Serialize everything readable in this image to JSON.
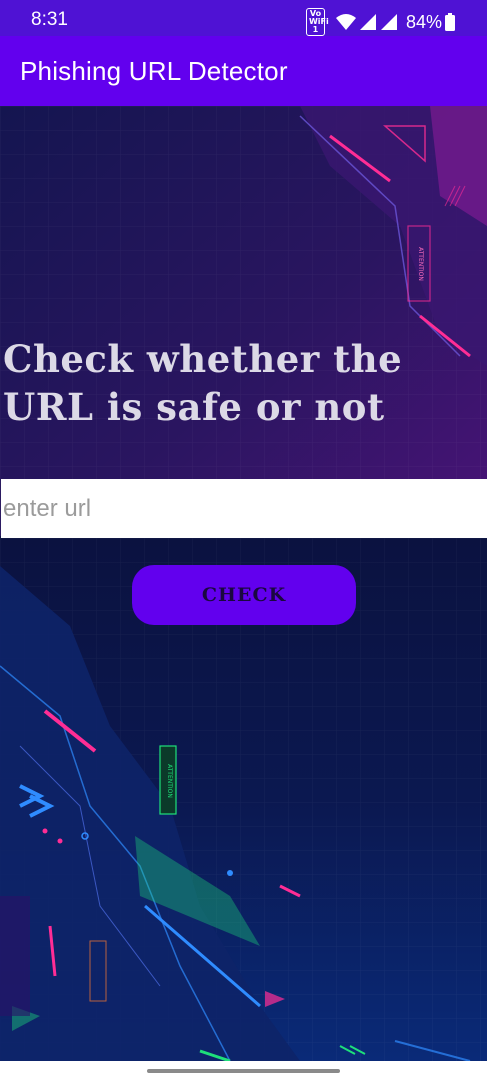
{
  "status_bar": {
    "time": "8:31",
    "vowifi_line1": "Vo",
    "vowifi_line2": "WiFi 1",
    "battery": "84%"
  },
  "app_bar": {
    "title": "Phishing URL Detector"
  },
  "main": {
    "headline": "Check whether the URL is safe or not",
    "url_input": {
      "value": "",
      "placeholder": "enter url"
    },
    "check_label": "CHECK"
  },
  "background": {
    "badge_text": "ATTENTION"
  },
  "colors": {
    "status_bar": "#4f12d4",
    "app_bar": "#6200ee",
    "button": "#6200ee",
    "background": "#0a0e3a",
    "headline": "#dcd9e6",
    "neon_pink": "#ff2d95",
    "neon_blue": "#2f8cff",
    "neon_green": "#1ee07a"
  }
}
